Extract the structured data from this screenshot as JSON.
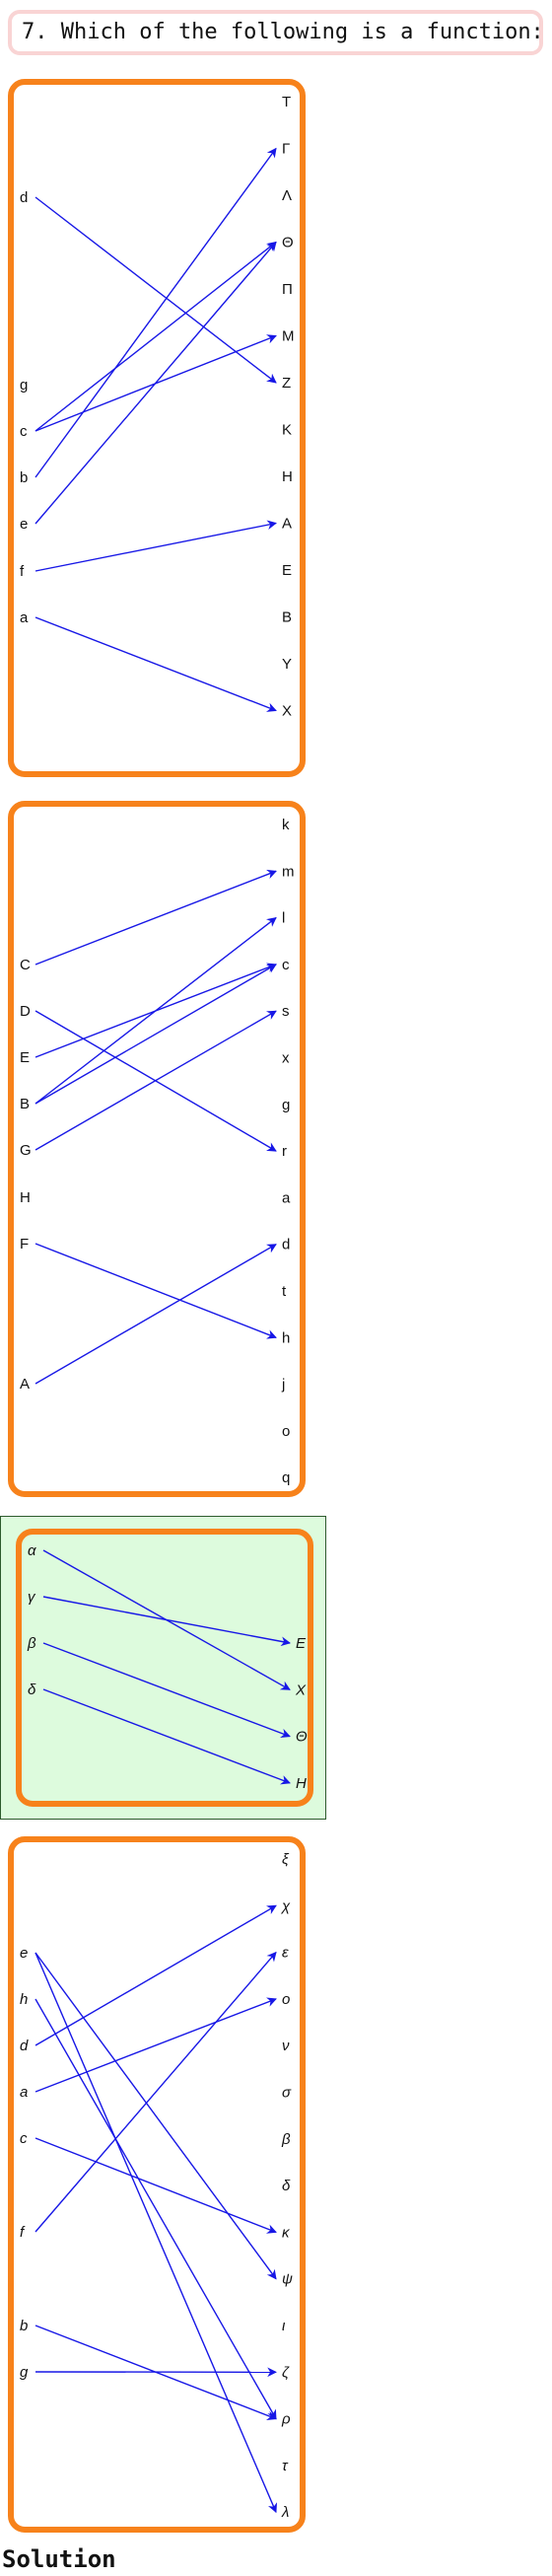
{
  "question": {
    "text": "7. Which of the following is a function:"
  },
  "solution": {
    "label": "Solution"
  },
  "colors": {
    "frame": "#f7821b",
    "arrow": "#1717e6",
    "highlight_fill": "#ddfbdd",
    "highlight_border": "#2d5b2d",
    "question_border": "#f9d4d4"
  },
  "panels": [
    {
      "id": "1",
      "highlighted": false,
      "domain": [
        "d",
        "g",
        "c",
        "b",
        "e",
        "f",
        "a"
      ],
      "codomain": [
        "T",
        "Γ",
        "Λ",
        "Θ",
        "Π",
        "M",
        "Z",
        "K",
        "H",
        "A",
        "E",
        "B",
        "Y",
        "X"
      ],
      "mapping": [
        [
          "d",
          "Z"
        ],
        [
          "c",
          "Θ"
        ],
        [
          "c",
          "M"
        ],
        [
          "b",
          "Γ"
        ],
        [
          "e",
          "Θ"
        ],
        [
          "f",
          "A"
        ],
        [
          "a",
          "X"
        ]
      ],
      "italic": false
    },
    {
      "id": "2",
      "highlighted": false,
      "domain": [
        "C",
        "D",
        "E",
        "B",
        "G",
        "H",
        "F",
        "A"
      ],
      "codomain": [
        "k",
        "m",
        "l",
        "c",
        "s",
        "x",
        "g",
        "r",
        "a",
        "d",
        "t",
        "h",
        "j",
        "o",
        "q"
      ],
      "mapping": [
        [
          "C",
          "m"
        ],
        [
          "D",
          "r"
        ],
        [
          "E",
          "c"
        ],
        [
          "B",
          "l"
        ],
        [
          "B",
          "c"
        ],
        [
          "G",
          "s"
        ],
        [
          "F",
          "h"
        ],
        [
          "A",
          "d"
        ]
      ],
      "italic": false
    },
    {
      "id": "3",
      "highlighted": true,
      "domain": [
        "α",
        "γ",
        "β",
        "δ"
      ],
      "codomain": [
        "E",
        "X",
        "Θ",
        "H"
      ],
      "mapping": [
        [
          "α",
          "X"
        ],
        [
          "γ",
          "E"
        ],
        [
          "β",
          "Θ"
        ],
        [
          "δ",
          "H"
        ]
      ],
      "italic": true
    },
    {
      "id": "4",
      "highlighted": false,
      "domain": [
        "e",
        "h",
        "d",
        "a",
        "c",
        "f",
        "b",
        "g"
      ],
      "codomain": [
        "ξ",
        "χ",
        "ε",
        "o",
        "ν",
        "σ",
        "β",
        "δ",
        "κ",
        "ψ",
        "ι",
        "ζ",
        "ρ",
        "τ",
        "λ"
      ],
      "mapping": [
        [
          "e",
          "ψ"
        ],
        [
          "e",
          "λ"
        ],
        [
          "h",
          "ρ"
        ],
        [
          "d",
          "χ"
        ],
        [
          "a",
          "o"
        ],
        [
          "c",
          "κ"
        ],
        [
          "f",
          "ε"
        ],
        [
          "b",
          "ρ"
        ],
        [
          "g",
          "ζ"
        ]
      ],
      "italic": true
    }
  ]
}
